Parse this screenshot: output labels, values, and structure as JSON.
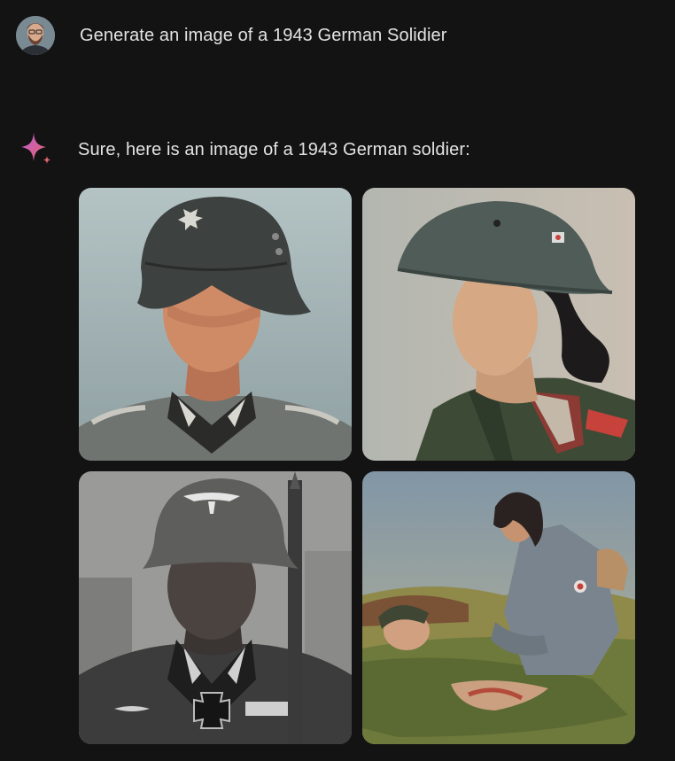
{
  "conversation": {
    "user_prompt": "Generate an image of a 1943 German Solidier",
    "assistant_reply": "Sure, here is an image of a 1943 German soldier:"
  },
  "generated_images": [
    {
      "subject": "soldier portrait in helmet, grey-blue backdrop"
    },
    {
      "subject": "woman in helmet and green uniform, side profile"
    },
    {
      "subject": "black-and-white soldier portrait with rifle"
    },
    {
      "subject": "painted scene: woman tending wounded soldier in field"
    }
  ],
  "colors": {
    "background": "#131314",
    "text": "#e3e3e3",
    "sparkle_start": "#c05bd8",
    "sparkle_end": "#e2676a"
  }
}
